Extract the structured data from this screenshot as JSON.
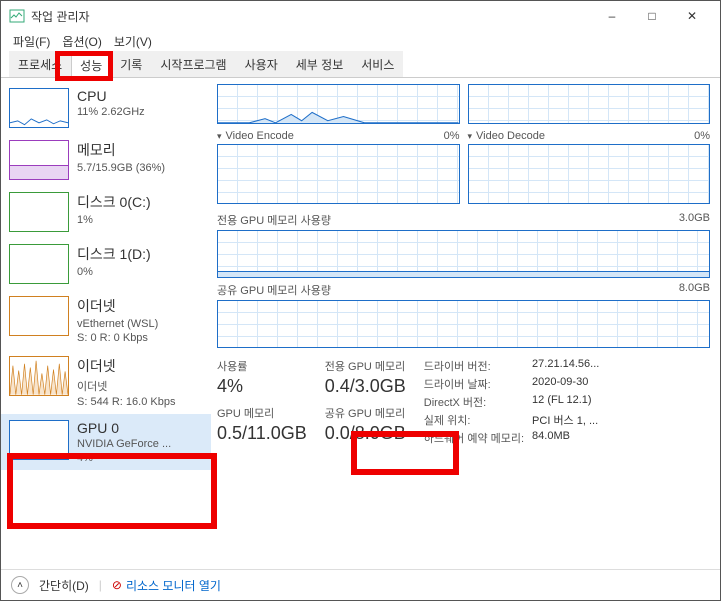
{
  "window": {
    "title": "작업 관리자",
    "minimize": "–",
    "maximize": "□",
    "close": "✕"
  },
  "menu": {
    "file": "파일(F)",
    "options": "옵션(O)",
    "view": "보기(V)"
  },
  "tabs": {
    "processes": "프로세스",
    "performance": "성능",
    "history": "기록",
    "startup": "시작프로그램",
    "users": "사용자",
    "details": "세부 정보",
    "services": "서비스"
  },
  "sidebar": [
    {
      "title": "CPU",
      "sub1": "11% 2.62GHz",
      "color": "blue"
    },
    {
      "title": "메모리",
      "sub1": "5.7/15.9GB (36%)",
      "color": "purple"
    },
    {
      "title": "디스크 0(C:)",
      "sub1": "1%",
      "color": "green"
    },
    {
      "title": "디스크 1(D:)",
      "sub1": "0%",
      "color": "green"
    },
    {
      "title": "이더넷",
      "sub1": "vEthernet (WSL)",
      "sub2": "S: 0 R: 0 Kbps",
      "color": "orange"
    },
    {
      "title": "이더넷",
      "sub1": "이더넷",
      "sub2": "S: 544 R: 16.0 Kbps",
      "color": "orange"
    },
    {
      "title": "GPU 0",
      "sub1": "NVIDIA GeForce ...",
      "sub2": "4%",
      "color": "blue"
    }
  ],
  "detail": {
    "encode": {
      "label": "Video Encode",
      "pct": "0%"
    },
    "decode": {
      "label": "Video Decode",
      "pct": "0%"
    },
    "dedicated": {
      "label": "전용 GPU 메모리 사용량",
      "max": "3.0GB"
    },
    "shared": {
      "label": "공유 GPU 메모리 사용량",
      "max": "8.0GB"
    }
  },
  "stats": {
    "usage": {
      "label": "사용률",
      "value": "4%"
    },
    "dedicated_mem": {
      "label": "전용 GPU 메모리",
      "value": "0.4/3.0GB"
    },
    "gpu_mem": {
      "label": "GPU 메모리",
      "value": "0.5/11.0GB"
    },
    "shared_mem": {
      "label": "공유 GPU 메모리",
      "value": "0.0/8.0GB"
    }
  },
  "info": {
    "driver_ver_label": "드라이버 버전:",
    "driver_ver": "27.21.14.56...",
    "driver_date_label": "드라이버 날짜:",
    "driver_date": "2020-09-30",
    "directx_label": "DirectX 버전:",
    "directx": "12 (FL 12.1)",
    "location_label": "실제 위치:",
    "location": "PCI 버스 1, ...",
    "reserved_label": "하드웨어 예약 메모리:",
    "reserved": "84.0MB"
  },
  "footer": {
    "brief": "간단히(D)",
    "monitor": "리소스 모니터 열기"
  }
}
